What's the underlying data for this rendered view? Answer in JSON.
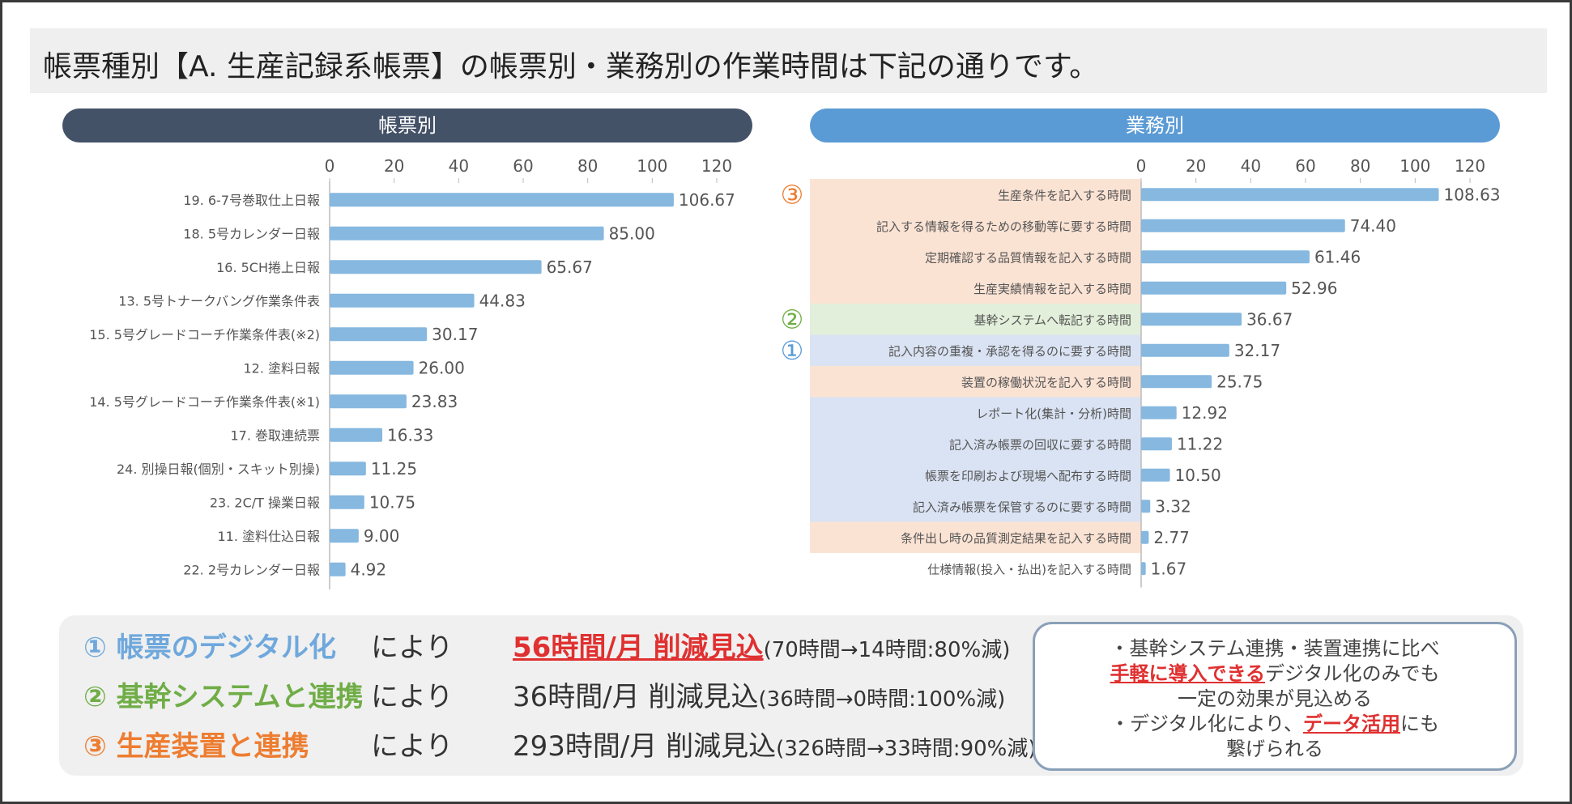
{
  "header": {
    "title": "帳票種別【A. 生産記録系帳票】の帳票別・業務別の作業時間は下記の通りです。"
  },
  "colors": {
    "dark_navy": "#445268",
    "blue": "#5b9bd5",
    "bar": "#86b8e0",
    "orange": "#ed7d31",
    "green": "#70ad47",
    "orange_bg": "#fbe3d4",
    "green_bg": "#e2efda",
    "blue_bg": "#dae3f3",
    "red": "#e03030"
  },
  "chart_data": [
    {
      "type": "bar",
      "title": "帳票別",
      "orientation": "horizontal",
      "xlim": [
        0,
        120
      ],
      "ticks": [
        0,
        20,
        40,
        60,
        80,
        100,
        120
      ],
      "categories": [
        "19. 6-7号巻取仕上日報",
        "18. 5号カレンダー日報",
        "16. 5CH捲上日報",
        "13. 5号トナークバング作業条件表",
        "15. 5号グレードコーチ作業条件表(※2)",
        "12. 塗料日報",
        "14. 5号グレードコーチ作業条件表(※1)",
        "17. 巻取連続票",
        "24. 別操日報(個別・スキット別操)",
        "23. 2C/T 操業日報",
        "11. 塗料仕込日報",
        "22. 2号カレンダー日報"
      ],
      "values": [
        106.67,
        85.0,
        65.67,
        44.83,
        30.17,
        26.0,
        23.83,
        16.33,
        11.25,
        10.75,
        9.0,
        4.92
      ],
      "labels": [
        "106.67",
        "85.00",
        "65.67",
        "44.83",
        "30.17",
        "26.00",
        "23.83",
        "16.33",
        "11.25",
        "10.75",
        "9.00",
        "4.92"
      ]
    },
    {
      "type": "bar",
      "title": "業務別",
      "orientation": "horizontal",
      "xlim": [
        0,
        120
      ],
      "ticks": [
        0,
        20,
        40,
        60,
        80,
        100,
        120
      ],
      "categories": [
        "生産条件を記入する時間",
        "記入する情報を得るための移動等に要する時間",
        "定期確認する品質情報を記入する時間",
        "生産実績情報を記入する時間",
        "基幹システムへ転記する時間",
        "記入内容の重複・承認を得るのに要する時間",
        "装置の稼働状況を記入する時間",
        "レポート化(集計・分析)時間",
        "記入済み帳票の回収に要する時間",
        "帳票を印刷および現場へ配布する時間",
        "記入済み帳票を保管するのに要する時間",
        "条件出し時の品質測定結果を記入する時間",
        "仕様情報(投入・払出)を記入する時間"
      ],
      "values": [
        108.63,
        74.4,
        61.46,
        52.96,
        36.67,
        32.17,
        25.75,
        12.92,
        11.22,
        10.5,
        3.32,
        2.77,
        1.67
      ],
      "labels": [
        "108.63",
        "74.40",
        "61.46",
        "52.96",
        "36.67",
        "32.17",
        "25.75",
        "12.92",
        "11.22",
        "10.50",
        "3.32",
        "2.77",
        "1.67"
      ],
      "groups": [
        "orange",
        "orange",
        "orange",
        "orange",
        "green",
        "blue",
        "orange",
        "blue",
        "blue",
        "blue",
        "blue",
        "orange",
        "none"
      ],
      "markers": [
        {
          "row": 0,
          "text": "③",
          "color": "orange"
        },
        {
          "row": 4,
          "text": "②",
          "color": "green"
        },
        {
          "row": 5,
          "text": "①",
          "color": "blue"
        }
      ]
    }
  ],
  "summary": [
    {
      "label": "① 帳票のデジタル化",
      "yori": "により",
      "amount": "56時間/月 削減見込",
      "detail": "(70時間→14時間:80%減)",
      "color": "#6fa8dc",
      "highlight": true
    },
    {
      "label": "② 基幹システムと連携",
      "yori": "により",
      "amount": "36時間/月 削減見込",
      "detail": "(36時間→0時間:100%減)",
      "color": "#70ad47",
      "highlight": false
    },
    {
      "label": "③ 生産装置と連携",
      "yori": "により",
      "amount": "293時間/月 削減見込",
      "detail": "(326時間→33時間:90%減)",
      "color": "#ed7d31",
      "highlight": false
    }
  ],
  "note": {
    "line1": "・基幹システム連携・装置連携に比べ",
    "line2_em": "手軽に導入できる",
    "line2_rest": "デジタル化のみでも",
    "line3": "一定の効果が見込める",
    "line4_pre": "・デジタル化により、",
    "line4_em": "データ活用",
    "line4_post": "にも",
    "line5": "繋げられる"
  }
}
